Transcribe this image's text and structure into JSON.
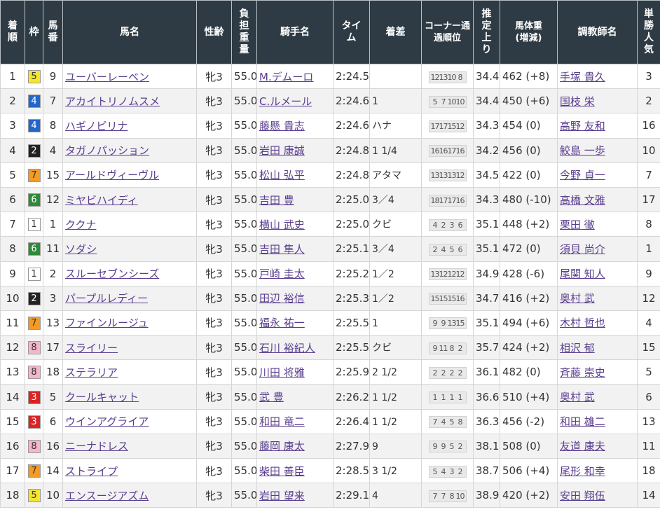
{
  "colors": {
    "header_bg": "#2e3b44",
    "link": "#5a3d8f",
    "waku": {
      "1": {
        "bg": "#ffffff",
        "fg": "#333333"
      },
      "2": {
        "bg": "#222222",
        "fg": "#ffffff"
      },
      "3": {
        "bg": "#dd2222",
        "fg": "#ffffff"
      },
      "4": {
        "bg": "#2266cc",
        "fg": "#ffffff"
      },
      "5": {
        "bg": "#f5e52b",
        "fg": "#333333"
      },
      "6": {
        "bg": "#2e8b3a",
        "fg": "#ffffff"
      },
      "7": {
        "bg": "#f59a23",
        "fg": "#333333"
      },
      "8": {
        "bg": "#f7b6c8",
        "fg": "#333333"
      }
    }
  },
  "headers": {
    "rank": "着順",
    "waku": "枠",
    "umaban": "馬番",
    "horse": "馬名",
    "sexage": "性齢",
    "weight": "負担重量",
    "jockey": "騎手名",
    "time": "タイム",
    "margin": "着差",
    "corner": "コーナー通過順位",
    "last3f": "推定上り",
    "body": "馬体重(増減)",
    "trainer": "調教師名",
    "pop": "単勝人気"
  },
  "rows": [
    {
      "rank": "1",
      "waku": "5",
      "umaban": "9",
      "horse": "ユーバーレーベン",
      "sexage": "牝3",
      "weight": "55.0",
      "jockey": "M.デムーロ",
      "time": "2:24.5",
      "margin": "",
      "corner": [
        "12",
        "13",
        "10",
        "8"
      ],
      "last3f": "34.4",
      "body": "462 (+8)",
      "trainer": "手塚 貴久",
      "pop": "3"
    },
    {
      "rank": "2",
      "waku": "4",
      "umaban": "7",
      "horse": "アカイトリノムスメ",
      "sexage": "牝3",
      "weight": "55.0",
      "jockey": "C.ルメール",
      "time": "2:24.6",
      "margin": "1",
      "corner": [
        "5",
        "7",
        "10",
        "10"
      ],
      "last3f": "34.4",
      "body": "450 (+6)",
      "trainer": "国枝 栄",
      "pop": "2"
    },
    {
      "rank": "3",
      "waku": "4",
      "umaban": "8",
      "horse": "ハギノピリナ",
      "sexage": "牝3",
      "weight": "55.0",
      "jockey": "藤懸 貴志",
      "time": "2:24.6",
      "margin": "ハナ",
      "corner": [
        "17",
        "17",
        "15",
        "12"
      ],
      "last3f": "34.3",
      "body": "454 (0)",
      "trainer": "高野 友和",
      "pop": "16"
    },
    {
      "rank": "4",
      "waku": "2",
      "umaban": "4",
      "horse": "タガノパッション",
      "sexage": "牝3",
      "weight": "55.0",
      "jockey": "岩田 康誠",
      "time": "2:24.8",
      "margin": "1 1/4",
      "corner": [
        "16",
        "16",
        "17",
        "16"
      ],
      "last3f": "34.2",
      "body": "456 (0)",
      "trainer": "鮫島 一歩",
      "pop": "10"
    },
    {
      "rank": "5",
      "waku": "7",
      "umaban": "15",
      "horse": "アールドヴィーヴル",
      "sexage": "牝3",
      "weight": "55.0",
      "jockey": "松山 弘平",
      "time": "2:24.8",
      "margin": "アタマ",
      "corner": [
        "13",
        "13",
        "13",
        "12"
      ],
      "last3f": "34.5",
      "body": "422 (0)",
      "trainer": "今野 貞一",
      "pop": "7"
    },
    {
      "rank": "6",
      "waku": "6",
      "umaban": "12",
      "horse": "ミヤビハイディ",
      "sexage": "牝3",
      "weight": "55.0",
      "jockey": "吉田 豊",
      "time": "2:25.0",
      "margin": "3／4",
      "corner": [
        "18",
        "17",
        "17",
        "16"
      ],
      "last3f": "34.3",
      "body": "480 (-10)",
      "trainer": "高橋 文雅",
      "pop": "17"
    },
    {
      "rank": "7",
      "waku": "1",
      "umaban": "1",
      "horse": "ククナ",
      "sexage": "牝3",
      "weight": "55.0",
      "jockey": "横山 武史",
      "time": "2:25.0",
      "margin": "クビ",
      "corner": [
        "4",
        "2",
        "3",
        "6"
      ],
      "last3f": "35.1",
      "body": "448 (+2)",
      "trainer": "栗田 徹",
      "pop": "8"
    },
    {
      "rank": "8",
      "waku": "6",
      "umaban": "11",
      "horse": "ソダシ",
      "sexage": "牝3",
      "weight": "55.0",
      "jockey": "吉田 隼人",
      "time": "2:25.1",
      "margin": "3／4",
      "corner": [
        "2",
        "4",
        "5",
        "6"
      ],
      "last3f": "35.1",
      "body": "472 (0)",
      "trainer": "須貝 尚介",
      "pop": "1"
    },
    {
      "rank": "9",
      "waku": "1",
      "umaban": "2",
      "horse": "スルーセブンシーズ",
      "sexage": "牝3",
      "weight": "55.0",
      "jockey": "戸崎 圭太",
      "time": "2:25.2",
      "margin": "1／2",
      "corner": [
        "13",
        "12",
        "12",
        "12"
      ],
      "last3f": "34.9",
      "body": "428 (-6)",
      "trainer": "尾関 知人",
      "pop": "9"
    },
    {
      "rank": "10",
      "waku": "2",
      "umaban": "3",
      "horse": "パープルレディー",
      "sexage": "牝3",
      "weight": "55.0",
      "jockey": "田辺 裕信",
      "time": "2:25.3",
      "margin": "1／2",
      "corner": [
        "15",
        "15",
        "15",
        "16"
      ],
      "last3f": "34.7",
      "body": "416 (+2)",
      "trainer": "奥村 武",
      "pop": "12"
    },
    {
      "rank": "11",
      "waku": "7",
      "umaban": "13",
      "horse": "ファインルージュ",
      "sexage": "牝3",
      "weight": "55.0",
      "jockey": "福永 祐一",
      "time": "2:25.5",
      "margin": "1",
      "corner": [
        "9",
        "9",
        "13",
        "15"
      ],
      "last3f": "35.1",
      "body": "494 (+6)",
      "trainer": "木村 哲也",
      "pop": "4"
    },
    {
      "rank": "12",
      "waku": "8",
      "umaban": "17",
      "horse": "スライリー",
      "sexage": "牝3",
      "weight": "55.0",
      "jockey": "石川 裕紀人",
      "time": "2:25.5",
      "margin": "クビ",
      "corner": [
        "9",
        "11",
        "8",
        "2"
      ],
      "last3f": "35.7",
      "body": "424 (+2)",
      "trainer": "相沢 郁",
      "pop": "15"
    },
    {
      "rank": "13",
      "waku": "8",
      "umaban": "18",
      "horse": "ステラリア",
      "sexage": "牝3",
      "weight": "55.0",
      "jockey": "川田 将雅",
      "time": "2:25.9",
      "margin": "2 1/2",
      "corner": [
        "2",
        "2",
        "2",
        "2"
      ],
      "last3f": "36.1",
      "body": "482 (0)",
      "trainer": "斉藤 崇史",
      "pop": "5"
    },
    {
      "rank": "14",
      "waku": "3",
      "umaban": "5",
      "horse": "クールキャット",
      "sexage": "牝3",
      "weight": "55.0",
      "jockey": "武 豊",
      "time": "2:26.2",
      "margin": "1 1/2",
      "corner": [
        "1",
        "1",
        "1",
        "1"
      ],
      "last3f": "36.6",
      "body": "510 (+4)",
      "trainer": "奥村 武",
      "pop": "6"
    },
    {
      "rank": "15",
      "waku": "3",
      "umaban": "6",
      "horse": "ウインアグライア",
      "sexage": "牝3",
      "weight": "55.0",
      "jockey": "和田 竜二",
      "time": "2:26.4",
      "margin": "1 1/2",
      "corner": [
        "7",
        "4",
        "5",
        "8"
      ],
      "last3f": "36.3",
      "body": "456 (-2)",
      "trainer": "和田 雄二",
      "pop": "13"
    },
    {
      "rank": "16",
      "waku": "8",
      "umaban": "16",
      "horse": "ニーナドレス",
      "sexage": "牝3",
      "weight": "55.0",
      "jockey": "藤岡 康太",
      "time": "2:27.9",
      "margin": "9",
      "corner": [
        "9",
        "9",
        "5",
        "2"
      ],
      "last3f": "38.1",
      "body": "508 (0)",
      "trainer": "友道 康夫",
      "pop": "11"
    },
    {
      "rank": "17",
      "waku": "7",
      "umaban": "14",
      "horse": "ストライプ",
      "sexage": "牝3",
      "weight": "55.0",
      "jockey": "柴田 善臣",
      "time": "2:28.5",
      "margin": "3 1/2",
      "corner": [
        "5",
        "4",
        "3",
        "2"
      ],
      "last3f": "38.7",
      "body": "506 (+4)",
      "trainer": "尾形 和幸",
      "pop": "18"
    },
    {
      "rank": "18",
      "waku": "5",
      "umaban": "10",
      "horse": "エンスージアズム",
      "sexage": "牝3",
      "weight": "55.0",
      "jockey": "岩田 望来",
      "time": "2:29.1",
      "margin": "4",
      "corner": [
        "7",
        "7",
        "8",
        "10"
      ],
      "last3f": "38.9",
      "body": "420 (+2)",
      "trainer": "安田 翔伍",
      "pop": "14"
    }
  ]
}
